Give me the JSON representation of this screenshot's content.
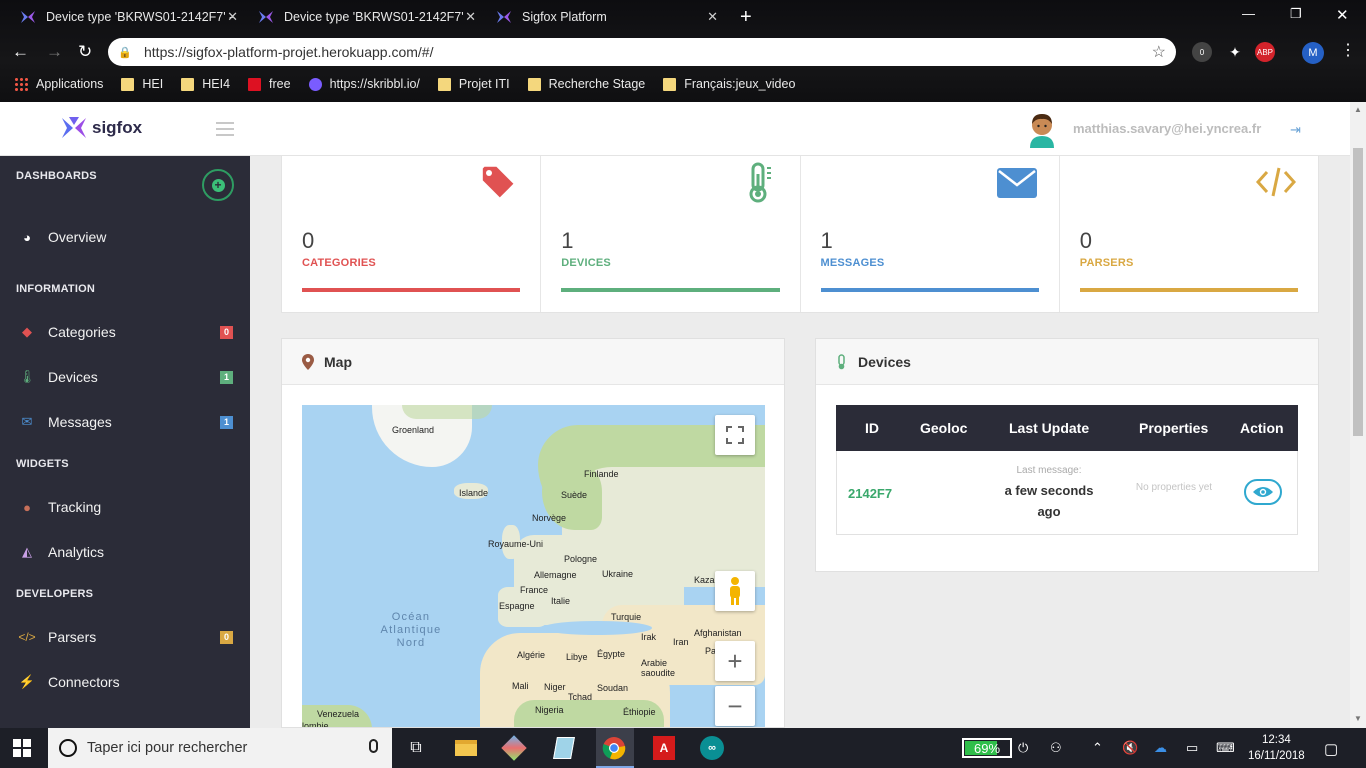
{
  "browser": {
    "tabs": [
      {
        "title": "Device type 'BKRWS01-2142F7' -"
      },
      {
        "title": "Device type 'BKRWS01-2142F7'"
      },
      {
        "title": "Sigfox Platform"
      }
    ],
    "url": "https://sigfox-platform-projet.herokuapp.com/#/",
    "extension_badges": {
      "counter": "0",
      "abp": "ABP",
      "profile": "M"
    },
    "bookmarks": [
      "Applications",
      "HEI",
      "HEI4",
      "free",
      "https://skribbl.io/",
      "Projet ITI",
      "Recherche Stage",
      "Français:jeux_video"
    ]
  },
  "header": {
    "logo_text": "sigfox",
    "user_email": "matthias.savary@hei.yncrea.fr"
  },
  "sidebar": {
    "sections": {
      "dashboards": "DASHBOARDS",
      "information": "INFORMATION",
      "widgets": "WIDGETS",
      "developers": "DEVELOPERS"
    },
    "items": {
      "overview": {
        "label": "Overview"
      },
      "categories": {
        "label": "Categories",
        "badge": "0"
      },
      "devices": {
        "label": "Devices",
        "badge": "1"
      },
      "messages": {
        "label": "Messages",
        "badge": "1"
      },
      "tracking": {
        "label": "Tracking"
      },
      "analytics": {
        "label": "Analytics"
      },
      "parsers": {
        "label": "Parsers",
        "badge": "0"
      },
      "connectors": {
        "label": "Connectors"
      }
    }
  },
  "stats": [
    {
      "value": "0",
      "label": "CATEGORIES",
      "color": "#e05252",
      "icon": "tag-icon"
    },
    {
      "value": "1",
      "label": "DEVICES",
      "color": "#5eaf7d",
      "icon": "thermometer-icon"
    },
    {
      "value": "1",
      "label": "MESSAGES",
      "color": "#4d8fd1",
      "icon": "envelope-icon"
    },
    {
      "value": "0",
      "label": "PARSERS",
      "color": "#d9a843",
      "icon": "code-icon"
    }
  ],
  "map_panel": {
    "title": "Map",
    "labels": {
      "groenland": "Groenland",
      "islande": "Islande",
      "finlande": "Finlande",
      "suede": "Suède",
      "norvege": "Norvège",
      "royaume_uni": "Royaume-Uni",
      "pologne": "Pologne",
      "allemagne": "Allemagne",
      "ukraine": "Ukraine",
      "france": "France",
      "kazakh": "Kazakh",
      "espagne": "Espagne",
      "italie": "Italie",
      "turquie": "Turquie",
      "irak": "Irak",
      "iran": "Iran",
      "afghanistan": "Afghanistan",
      "algerie": "Algérie",
      "libye": "Libye",
      "egypte": "Égypte",
      "arabie": "Arabie saoudite",
      "pa": "Pa",
      "mali": "Mali",
      "niger": "Niger",
      "tchad": "Tchad",
      "soudan": "Soudan",
      "venezuela": "Venezuela",
      "nigeria": "Nigeria",
      "ethiopie": "Éthiopie",
      "colombie": "lombie",
      "ocean_line1": "Océan",
      "ocean_line2": "Atlantique",
      "ocean_line3": "Nord"
    }
  },
  "devices_panel": {
    "title": "Devices",
    "columns": [
      "ID",
      "Geoloc",
      "Last Update",
      "Properties",
      "Action"
    ],
    "rows": [
      {
        "id": "2142F7",
        "last_update_caption": "Last message:",
        "last_update_value": "a few seconds ago",
        "properties": "No properties yet"
      }
    ]
  },
  "taskbar": {
    "search_placeholder": "Taper ici pour rechercher",
    "battery": "69%",
    "time": "12:34",
    "date": "16/11/2018"
  }
}
